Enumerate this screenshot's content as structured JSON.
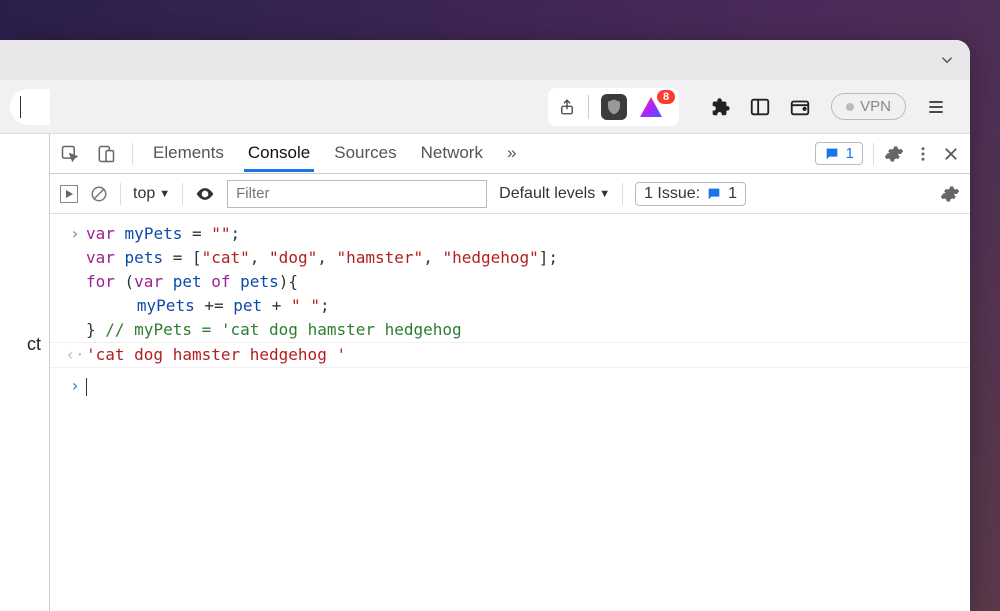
{
  "browser": {
    "bat_badge": "8",
    "vpn_label": "VPN"
  },
  "devtools": {
    "tabs": {
      "elements": "Elements",
      "console": "Console",
      "sources": "Sources",
      "network": "Network",
      "more": "»"
    },
    "top_issue_count": "1",
    "filterbar": {
      "context": "top",
      "context_arrow": "▼",
      "filter_placeholder": "Filter",
      "levels_label": "Default levels",
      "levels_arrow": "▼",
      "issue_label": "1 Issue:",
      "issue_count": "1"
    }
  },
  "page_text": "ct",
  "console": {
    "code": {
      "l1_kw1": "var",
      "l1_var": "myPets",
      "l1_rest": " = ",
      "l1_str": "\"\"",
      "l1_end": ";",
      "l2_kw1": "var",
      "l2_var": "pets",
      "l2_rest": " = [",
      "l2_s1": "\"cat\"",
      "l2_c": ", ",
      "l2_s2": "\"dog\"",
      "l2_s3": "\"hamster\"",
      "l2_s4": "\"hedgehog\"",
      "l2_end": "];",
      "l3_kw1": "for",
      "l3_p1": " (",
      "l3_kw2": "var",
      "l3_var": "pet",
      "l3_kw3": "of",
      "l3_var2": "pets",
      "l3_end": "){",
      "l4_var": "myPets",
      "l4_op": " += ",
      "l4_var2": "pet",
      "l4_plus": " + ",
      "l4_str": "\" \"",
      "l4_end": ";",
      "l5_brace": "}",
      "l5_comment": " // myPets = 'cat dog hamster hedgehog"
    },
    "output": "'cat dog hamster hedgehog '"
  }
}
